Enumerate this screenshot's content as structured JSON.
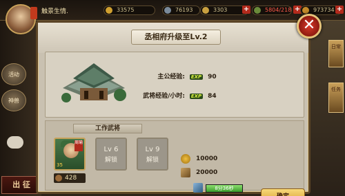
{
  "topbar": {
    "player_name": "触景生情.",
    "resources": [
      {
        "icon": "gold-coin-icon",
        "value": "33575"
      },
      {
        "icon": "iron-icon",
        "value": "76193"
      },
      {
        "icon": "grain-icon",
        "value": "3303"
      },
      {
        "icon": "soldier-icon",
        "value": "5804/218",
        "color": "#ff5a4a"
      },
      {
        "icon": "copper-coin-icon",
        "value": "973734"
      }
    ],
    "plus": "+"
  },
  "side_left": {
    "items": [
      "活动",
      "神兽"
    ],
    "expedition": "出 征"
  },
  "side_right": {
    "tab1": "日常",
    "tab2": "任务"
  },
  "dialog": {
    "title": "丞相府升级至Lv.2",
    "close": "✕",
    "lord_exp_label": "主公经验:",
    "lord_exp_value": "90",
    "general_exp_label": "武将经验/小时:",
    "general_exp_value": "84",
    "exp_badge": "EXP",
    "workers_title": "工作武将",
    "hero": {
      "name_badge": "周瑜",
      "level": "35",
      "stat": "428"
    },
    "slots": [
      {
        "level": "Lv 6",
        "status": "解锁"
      },
      {
        "level": "Lv 9",
        "status": "解锁"
      }
    ],
    "costs": {
      "gold": "10000",
      "wood": "20000",
      "time": "8分36秒",
      "time_progress_percent": 100
    },
    "confirm": "确定"
  },
  "colors": {
    "dialog_border": "#5c4526",
    "close_red": "#d83a2a",
    "confirm_gold": "#f8d97a",
    "exp_green": "#2a4a18"
  }
}
